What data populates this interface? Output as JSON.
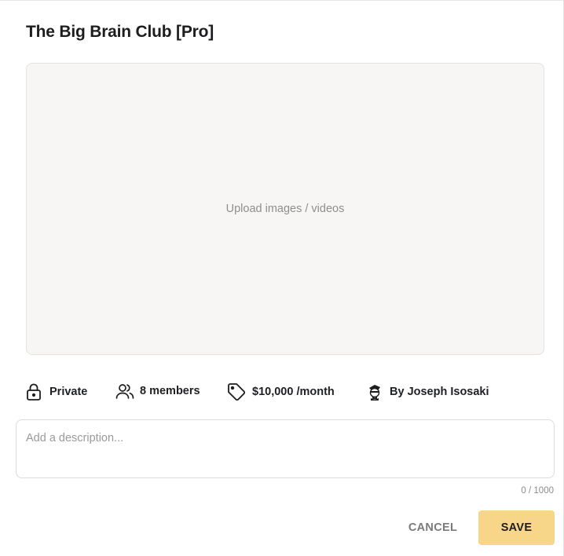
{
  "group": {
    "title": "The Big Brain Club [Pro]"
  },
  "upload": {
    "label": "Upload images / videos"
  },
  "meta": {
    "privacy": {
      "icon": "lock-icon",
      "label": "Private"
    },
    "members": {
      "icon": "users-icon",
      "label": "8 members"
    },
    "price": {
      "icon": "tag-icon",
      "label": "$10,000 /month"
    },
    "author": {
      "icon": "avatar-icon",
      "label": "By Joseph Isosaki"
    }
  },
  "description": {
    "value": "",
    "placeholder": "Add a description...",
    "counter": "0 / 1000"
  },
  "actions": {
    "cancel_label": "CANCEL",
    "save_label": "SAVE"
  },
  "colors": {
    "save_button_bg": "#f7d68a",
    "upload_bg": "#f7f6f4"
  }
}
